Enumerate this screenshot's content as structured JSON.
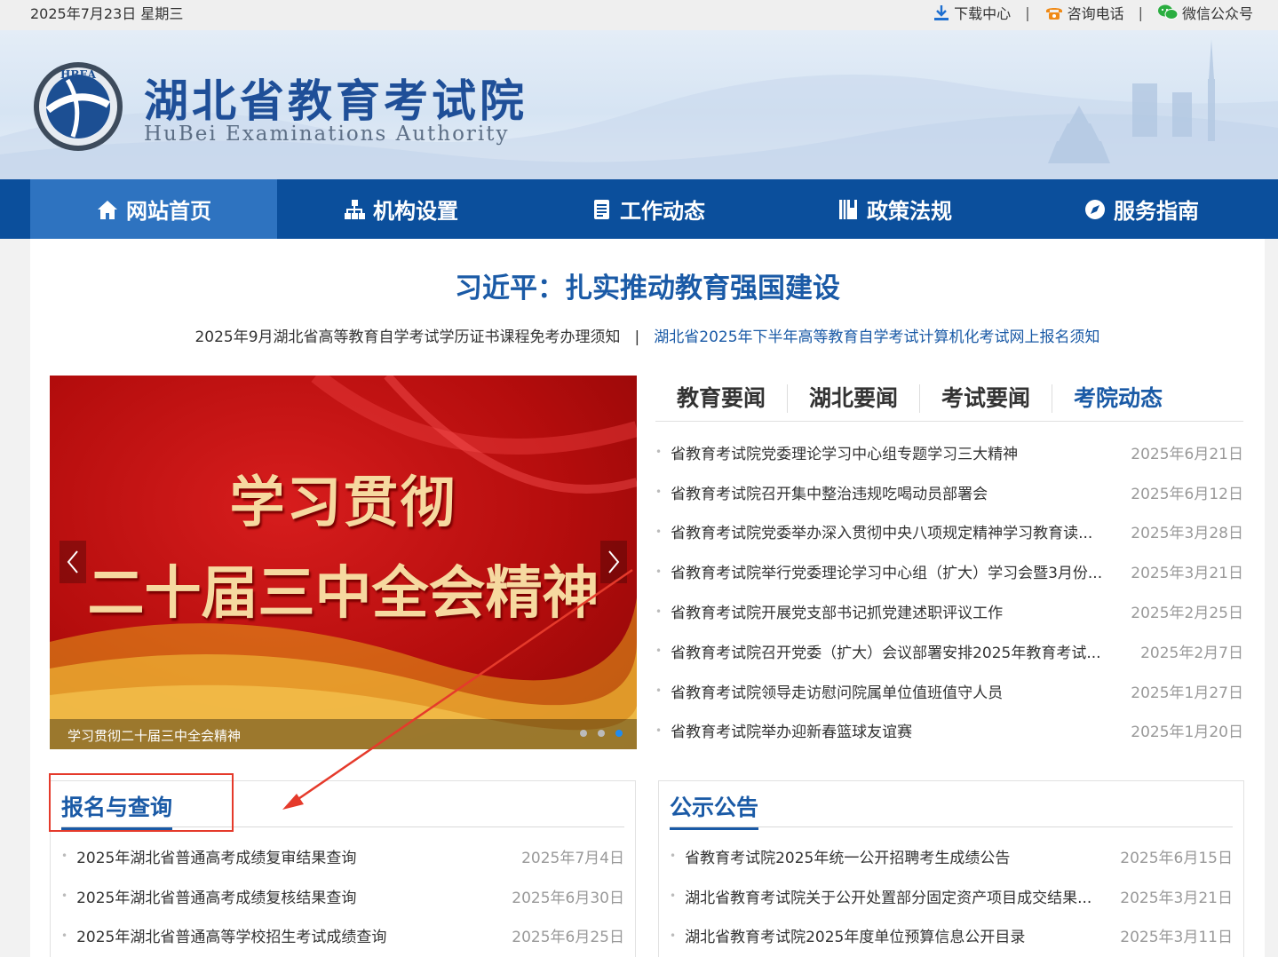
{
  "topbar": {
    "date": "2025年7月23日 星期三",
    "download": "下载中心",
    "phone": "咨询电话",
    "wechat": "微信公众号",
    "separator": "|"
  },
  "header": {
    "title": "湖北省教育考试院",
    "subtitle": "HuBei Examinations Authority",
    "logo_text": "HBEA"
  },
  "nav": [
    {
      "label": "网站首页",
      "icon": "home-icon"
    },
    {
      "label": "机构设置",
      "icon": "org-chart-icon"
    },
    {
      "label": "工作动态",
      "icon": "document-icon"
    },
    {
      "label": "政策法规",
      "icon": "book-icon"
    },
    {
      "label": "服务指南",
      "icon": "compass-icon"
    }
  ],
  "headline": "习近平：扎实推动教育强国建设",
  "subline": {
    "left": "2025年9月湖北省高等教育自学考试学历证书课程免考办理须知",
    "separator": "|",
    "right": "湖北省2025年下半年高等教育自学考试计算机化考试网上报名须知"
  },
  "slider": {
    "line1": "学习贯彻",
    "line2": "二十届三中全会精神",
    "caption": "学习贯彻二十届三中全会精神",
    "prev": "‹",
    "next": "›"
  },
  "news": {
    "tabs": [
      "教育要闻",
      "湖北要闻",
      "考试要闻",
      "考院动态"
    ],
    "items": [
      {
        "title": "省教育考试院党委理论学习中心组专题学习三大精神",
        "date": "2025年6月21日"
      },
      {
        "title": "省教育考试院召开集中整治违规吃喝动员部署会",
        "date": "2025年6月12日"
      },
      {
        "title": "省教育考试院党委举办深入贯彻中央八项规定精神学习教育读...",
        "date": "2025年3月28日"
      },
      {
        "title": "省教育考试院举行党委理论学习中心组（扩大）学习会暨3月份...",
        "date": "2025年3月21日"
      },
      {
        "title": "省教育考试院开展党支部书记抓党建述职评议工作",
        "date": "2025年2月25日"
      },
      {
        "title": "省教育考试院召开党委（扩大）会议部署安排2025年教育考试...",
        "date": "2025年2月7日"
      },
      {
        "title": "省教育考试院领导走访慰问院属单位值班值守人员",
        "date": "2025年1月27日"
      },
      {
        "title": "省教育考试院举办迎新春篮球友谊赛",
        "date": "2025年1月20日"
      }
    ]
  },
  "registration": {
    "title": "报名与查询",
    "items": [
      {
        "title": "2025年湖北省普通高考成绩复审结果查询",
        "date": "2025年7月4日"
      },
      {
        "title": "2025年湖北省普通高考成绩复核结果查询",
        "date": "2025年6月30日"
      },
      {
        "title": "2025年湖北省普通高等学校招生考试成绩查询",
        "date": "2025年6月25日"
      }
    ]
  },
  "notices": {
    "title": "公示公告",
    "items": [
      {
        "title": "省教育考试院2025年统一公开招聘考生成绩公告",
        "date": "2025年6月15日"
      },
      {
        "title": "湖北省教育考试院关于公开处置部分固定资产项目成交结果...",
        "date": "2025年3月21日"
      },
      {
        "title": "湖北省教育考试院2025年度单位预算信息公开目录",
        "date": "2025年3月11日"
      }
    ]
  },
  "colors": {
    "brand": "#0b4f9c",
    "accent": "#1a5aa6",
    "annotation": "#e53a2b"
  }
}
